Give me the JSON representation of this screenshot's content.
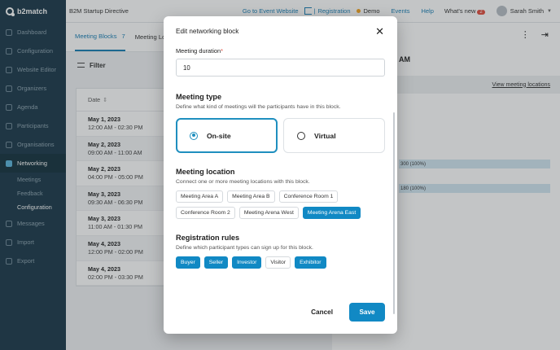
{
  "app": {
    "logo_text": "b2match",
    "event_title": "B2M Startup Directive"
  },
  "topbar": {
    "go_to_event": "Go to Event Website",
    "registration": "Registration",
    "demo": "Demo",
    "events": "Events",
    "help": "Help",
    "whats_new": "What's new",
    "whats_new_count": "2",
    "user_name": "Sarah Smith"
  },
  "sidebar": {
    "items": [
      {
        "label": "Dashboard"
      },
      {
        "label": "Configuration"
      },
      {
        "label": "Website Editor"
      },
      {
        "label": "Organizers"
      },
      {
        "label": "Agenda"
      },
      {
        "label": "Participants"
      },
      {
        "label": "Organisations"
      },
      {
        "label": "Networking"
      }
    ],
    "sub_items": [
      {
        "label": "Meetings"
      },
      {
        "label": "Feedback"
      },
      {
        "label": "Configuration"
      }
    ],
    "items_after": [
      {
        "label": "Messages"
      },
      {
        "label": "Import"
      },
      {
        "label": "Export"
      }
    ]
  },
  "main": {
    "tabs": [
      {
        "label": "Meeting Blocks",
        "count": "7"
      },
      {
        "label": "Meeting Lo"
      }
    ],
    "filter_label": "Filter",
    "date_header": "Date",
    "rows": [
      {
        "date": "May 1, 2023",
        "time": "12:00 AM - 02:30 PM"
      },
      {
        "date": "May 2, 2023",
        "time": "09:00 AM - 11:00 AM"
      },
      {
        "date": "May 2, 2023",
        "time": "04:00 PM - 05:00 PM"
      },
      {
        "date": "May 3, 2023",
        "time": "09:30 AM - 06:30 PM"
      },
      {
        "date": "May 3, 2023",
        "time": "11:00 AM - 01:30 PM"
      },
      {
        "date": "May 4, 2023",
        "time": "12:00 PM - 02:00 PM"
      },
      {
        "date": "May 4, 2023",
        "time": "02:00 PM - 03:30 PM"
      }
    ]
  },
  "right_panel": {
    "title_fragment": "AM",
    "view_locations": "View meeting locations",
    "bar1": "300 (100%)",
    "bar2": "180 (100%)"
  },
  "modal": {
    "title": "Edit networking block",
    "duration_label": "Meeting duration",
    "required_mark": "*",
    "duration_value": "10",
    "type_title": "Meeting type",
    "type_desc": "Define what kind of meetings will the participants have in this block.",
    "type_onsite": "On-site",
    "type_virtual": "Virtual",
    "location_title": "Meeting location",
    "location_desc": "Connect one or more meeting locations with this block.",
    "locations": [
      {
        "label": "Meeting Area A",
        "selected": false
      },
      {
        "label": "Meeting Area B",
        "selected": false
      },
      {
        "label": "Conference Room 1",
        "selected": false
      },
      {
        "label": "Conference Room 2",
        "selected": false
      },
      {
        "label": "Meeting Arena West",
        "selected": false
      },
      {
        "label": "Meeting Arena East",
        "selected": true
      }
    ],
    "rules_title": "Registration rules",
    "rules_desc": "Define which participant types can sign up for this block.",
    "rules": [
      {
        "label": "Buyer",
        "selected": true
      },
      {
        "label": "Seller",
        "selected": true
      },
      {
        "label": "Investor",
        "selected": true
      },
      {
        "label": "Visitor",
        "selected": false
      },
      {
        "label": "Exhibitor",
        "selected": true
      }
    ],
    "cancel": "Cancel",
    "save": "Save"
  },
  "colors": {
    "accent": "#1189c4",
    "sidebar": "#1c3a4b",
    "required": "#e24e3f"
  }
}
